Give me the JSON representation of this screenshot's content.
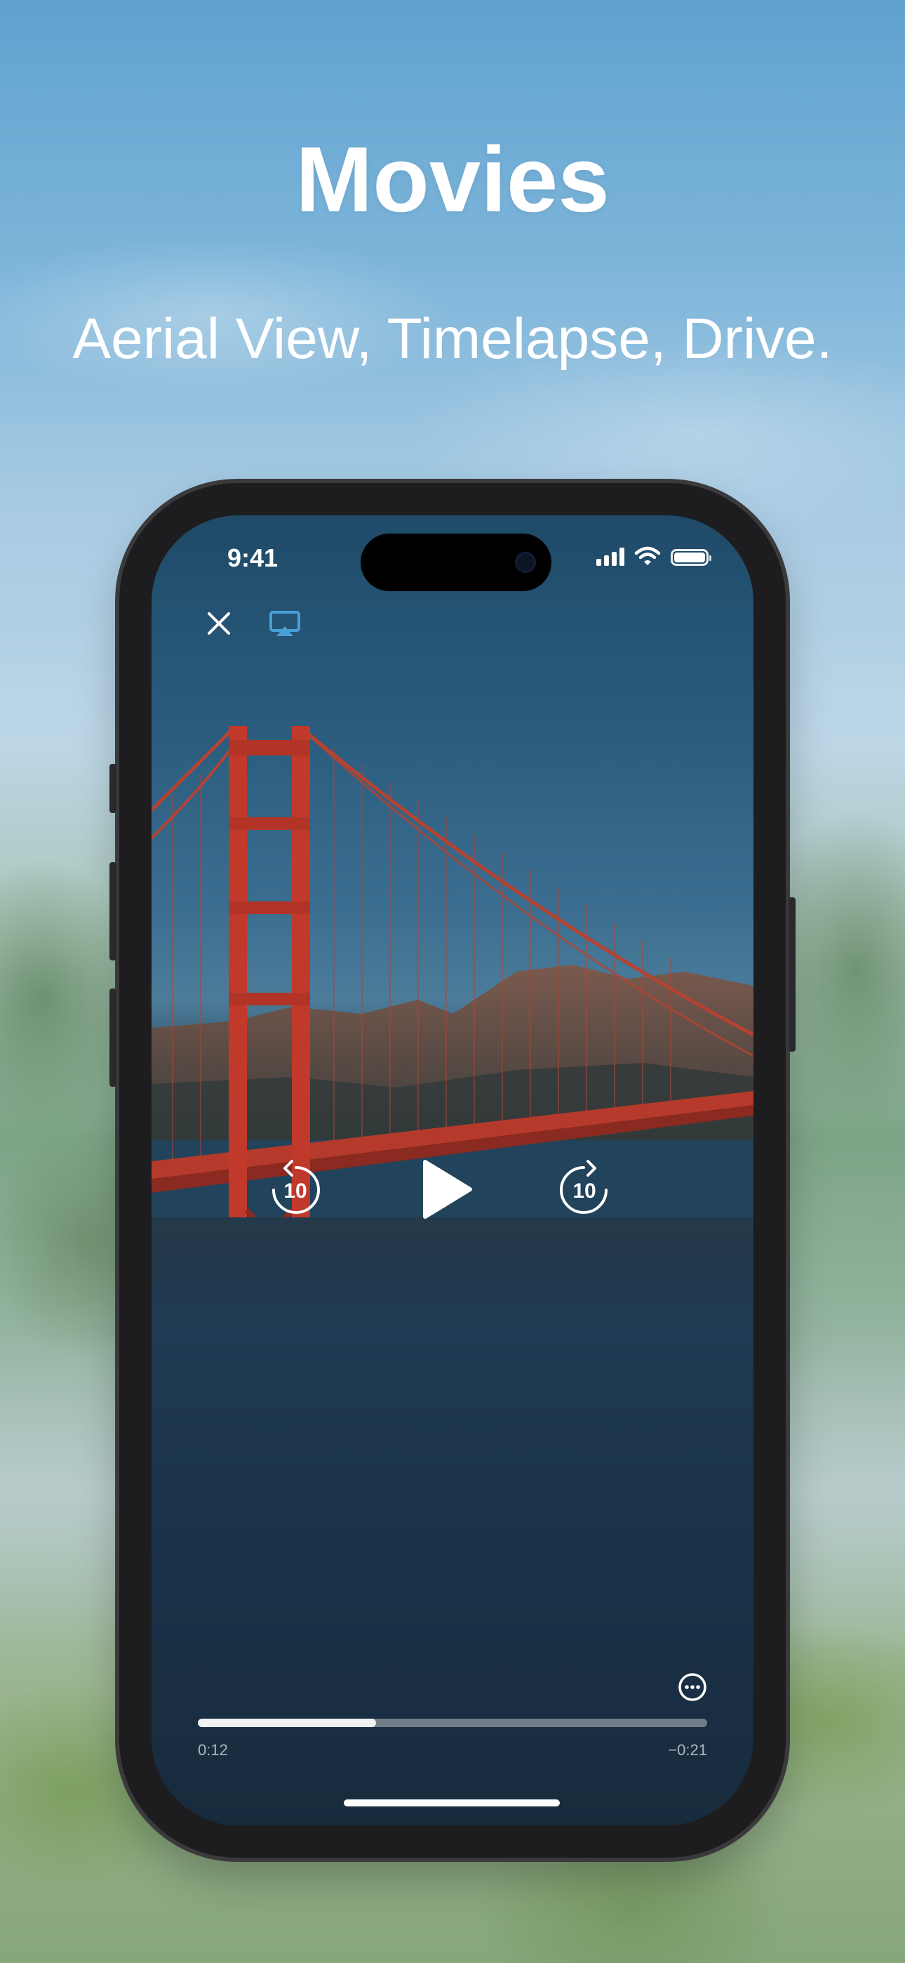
{
  "header": {
    "title": "Movies",
    "subtitle": "Aerial View, Timelapse, Drive."
  },
  "status_bar": {
    "time": "9:41",
    "icons": [
      "cellular-signal-icon",
      "wifi-icon",
      "battery-icon"
    ]
  },
  "player": {
    "top_controls": [
      "close-icon",
      "airplay-icon"
    ],
    "skip_back_seconds": "10",
    "skip_forward_seconds": "10",
    "elapsed": "0:12",
    "remaining": "−0:21",
    "progress_fraction": 0.35,
    "more_icon": "ellipsis-circle-icon"
  },
  "colors": {
    "accent_airplay": "#4a9fd8",
    "bridge": "#c0392b"
  }
}
